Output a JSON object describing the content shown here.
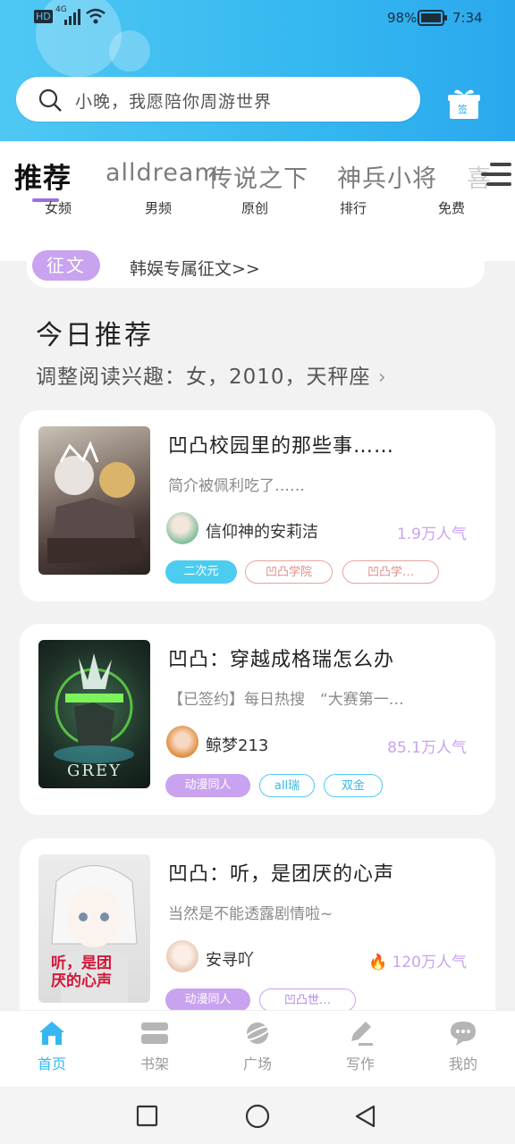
{
  "status_bar": {
    "network": "HD",
    "signal": "4G",
    "battery_pct": "98%",
    "time": "7:34"
  },
  "search": {
    "placeholder": "小晚，我愿陪你周游世界"
  },
  "sign_label": "签",
  "tabs": [
    {
      "label": "推荐",
      "sub": "女频",
      "active": true
    },
    {
      "label": "alldream",
      "sub": "男频"
    },
    {
      "label": "传说之下",
      "sub": "原创"
    },
    {
      "label": "神兵小将",
      "sub": "排行"
    },
    {
      "label": "喜",
      "sub": "免费"
    }
  ],
  "contest": {
    "badge": "征文",
    "text": "韩娱专属征文>>"
  },
  "recommend": {
    "title": "今日推荐",
    "subtitle": "调整阅读兴趣：女，2010，天秤座"
  },
  "books": [
    {
      "title": "凹凸校园里的那些事……",
      "desc": "简介被佩利吃了……",
      "author": "信仰神的安莉洁",
      "popularity": "1.9万人气",
      "tags": [
        "二次元",
        "凹凸学院",
        "凹凸学…"
      ]
    },
    {
      "title": "凹凸：穿越成格瑞怎么办",
      "desc": "【已签约】每日热搜　“大赛第一…",
      "author": "鲸梦213",
      "popularity": "85.1万人气",
      "cover_text": "GREY",
      "tags": [
        "动漫同人",
        "all瑞",
        "双金"
      ]
    },
    {
      "title": "凹凸：听，是团厌的心声",
      "desc": "当然是不能透露剧情啦~",
      "author": "安寻吖",
      "popularity": "120万人气",
      "cover_text": "听，是团厌的心声",
      "tags": [
        "动漫同人",
        "凹凸世…"
      ]
    }
  ],
  "bottom_nav": [
    {
      "label": "首页",
      "icon": "home-icon",
      "active": true
    },
    {
      "label": "书架",
      "icon": "bookshelf-icon"
    },
    {
      "label": "广场",
      "icon": "planet-icon"
    },
    {
      "label": "写作",
      "icon": "pen-icon"
    },
    {
      "label": "我的",
      "icon": "chat-bubble-icon"
    }
  ],
  "colors": {
    "accent_blue": "#35b8f0",
    "accent_purple": "#c9a3ef",
    "tag_red": "#e8a39e"
  }
}
